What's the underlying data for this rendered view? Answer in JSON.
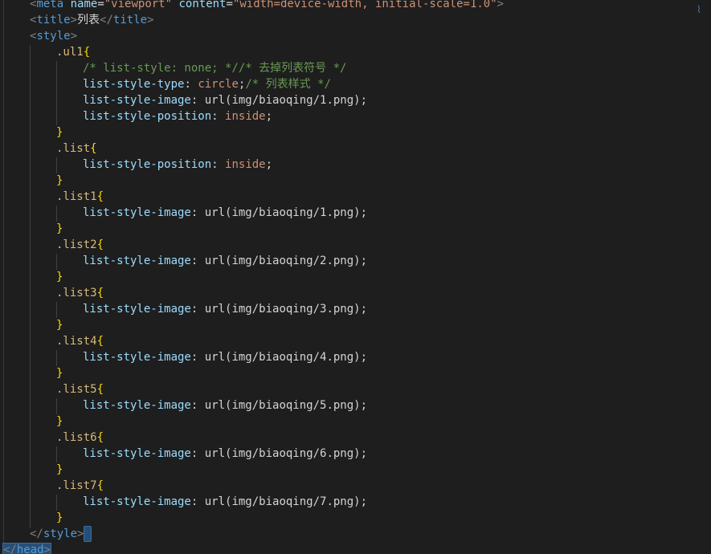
{
  "editor": {
    "line1": {
      "open": "<",
      "tag": "meta",
      "a1": "name",
      "eq1": "=",
      "v1": "\"viewport\"",
      "a2": "content",
      "eq2": "=",
      "v2": "\"width=device-width, initial-scale=1.0\"",
      "close": ">"
    },
    "line2": {
      "open": "<",
      "tag": "title",
      "gt": ">",
      "text": "列表",
      "open2": "</",
      "tag2": "title",
      "close": ">"
    },
    "line3": {
      "open": "<",
      "tag": "style",
      "close": ">"
    },
    "css": {
      "ul1_sel": ".ul1",
      "ul1_c1": "/* list-style: none; *//* 去掉列表符号 */",
      "ul1_p2": "list-style-type",
      "ul1_v2": "circle",
      "ul1_c2": "/* 列表样式 */",
      "ul1_p3": "list-style-image",
      "ul1_v3": "url(img/biaoqing/1.png)",
      "ul1_p4": "list-style-position",
      "ul1_v4": "inside",
      "list_sel": ".list",
      "list_p1": "list-style-position",
      "list_v1": "inside",
      "items": [
        {
          "sel": ".list1",
          "prop": "list-style-image",
          "val": "url(img/biaoqing/1.png)"
        },
        {
          "sel": ".list2",
          "prop": "list-style-image",
          "val": "url(img/biaoqing/2.png)"
        },
        {
          "sel": ".list3",
          "prop": "list-style-image",
          "val": "url(img/biaoqing/3.png)"
        },
        {
          "sel": ".list4",
          "prop": "list-style-image",
          "val": "url(img/biaoqing/4.png)"
        },
        {
          "sel": ".list5",
          "prop": "list-style-image",
          "val": "url(img/biaoqing/5.png)"
        },
        {
          "sel": ".list6",
          "prop": "list-style-image",
          "val": "url(img/biaoqing/6.png)"
        },
        {
          "sel": ".list7",
          "prop": "list-style-image",
          "val": "url(img/biaoqing/7.png)"
        }
      ],
      "open_brace": "{",
      "close_brace": "}",
      "colon": ":",
      "semi": ";"
    },
    "style_close": {
      "open": "</",
      "tag": "style",
      "close": ">"
    },
    "head_close": {
      "open": "</",
      "tag": "head",
      "close": ">"
    }
  },
  "colors": {
    "background": "#1e1e1e",
    "tag": "#569cd6",
    "attr": "#9cdcfe",
    "string": "#ce9178",
    "selector": "#d7ba7d",
    "brace": "#ffd700",
    "comment": "#6a9955",
    "function": "#dcdcaa"
  }
}
